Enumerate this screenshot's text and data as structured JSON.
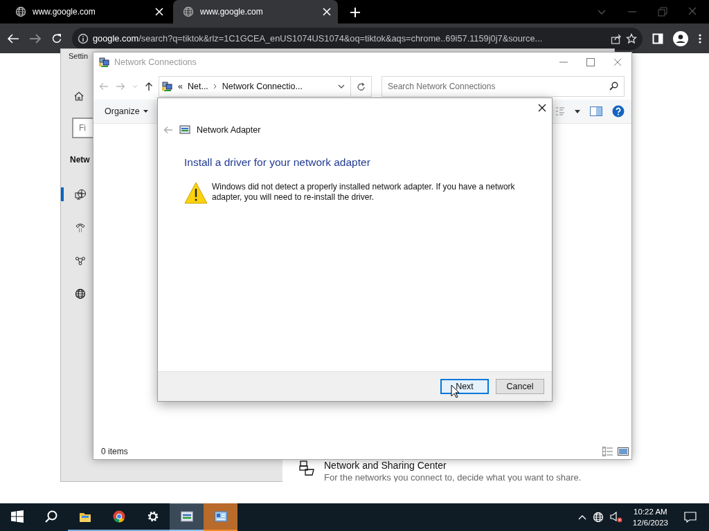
{
  "browser": {
    "tabs": [
      {
        "title": "www.google.com",
        "selected": false
      },
      {
        "title": "www.google.com",
        "selected": true
      }
    ],
    "address": {
      "host": "google.com",
      "rest": "/search?q=tiktok&rlz=1C1GCEA_enUS1074US1074&oq=tiktok&aqs=chrome..69i57.1159j0j7&source..."
    }
  },
  "settings_window": {
    "title": "Settin",
    "search_placeholder": "Fi",
    "heading": "Netw",
    "nav": [
      {
        "kind": "ethernet",
        "selected": true
      },
      {
        "kind": "dialup",
        "selected": false
      },
      {
        "kind": "vpn",
        "selected": false
      },
      {
        "kind": "proxy",
        "selected": false
      }
    ],
    "link": {
      "title": "Network and Sharing Center",
      "description": "For the networks you connect to, decide what you want to share."
    }
  },
  "explorer_window": {
    "title": "Network Connections",
    "path_prefix": "«",
    "path": [
      "Net...",
      "Network Connectio..."
    ],
    "search_placeholder": "Search Network Connections",
    "organize": "Organize",
    "status": "0 items"
  },
  "dialog": {
    "nav_title": "Network Adapter",
    "heading": "Install a driver for your network adapter",
    "message": "Windows did not detect a properly installed network adapter. If you have a network adapter, you will need to re-install the driver.",
    "buttons": [
      {
        "label": "Next",
        "focused": true
      },
      {
        "label": "Cancel",
        "focused": false
      }
    ]
  },
  "taskbar": {
    "apps": [
      {
        "kind": "start",
        "running": false,
        "selected": false,
        "flashing": false
      },
      {
        "kind": "search",
        "running": false,
        "selected": false,
        "flashing": false
      },
      {
        "kind": "explorer",
        "running": true,
        "selected": false,
        "flashing": false
      },
      {
        "kind": "chrome",
        "running": true,
        "selected": false,
        "flashing": false
      },
      {
        "kind": "settings",
        "running": true,
        "selected": false,
        "flashing": false
      },
      {
        "kind": "network",
        "running": true,
        "selected": true,
        "flashing": false
      },
      {
        "kind": "control",
        "running": true,
        "selected": false,
        "flashing": true
      }
    ],
    "time": "10:22 AM",
    "date": "12/6/2023"
  }
}
